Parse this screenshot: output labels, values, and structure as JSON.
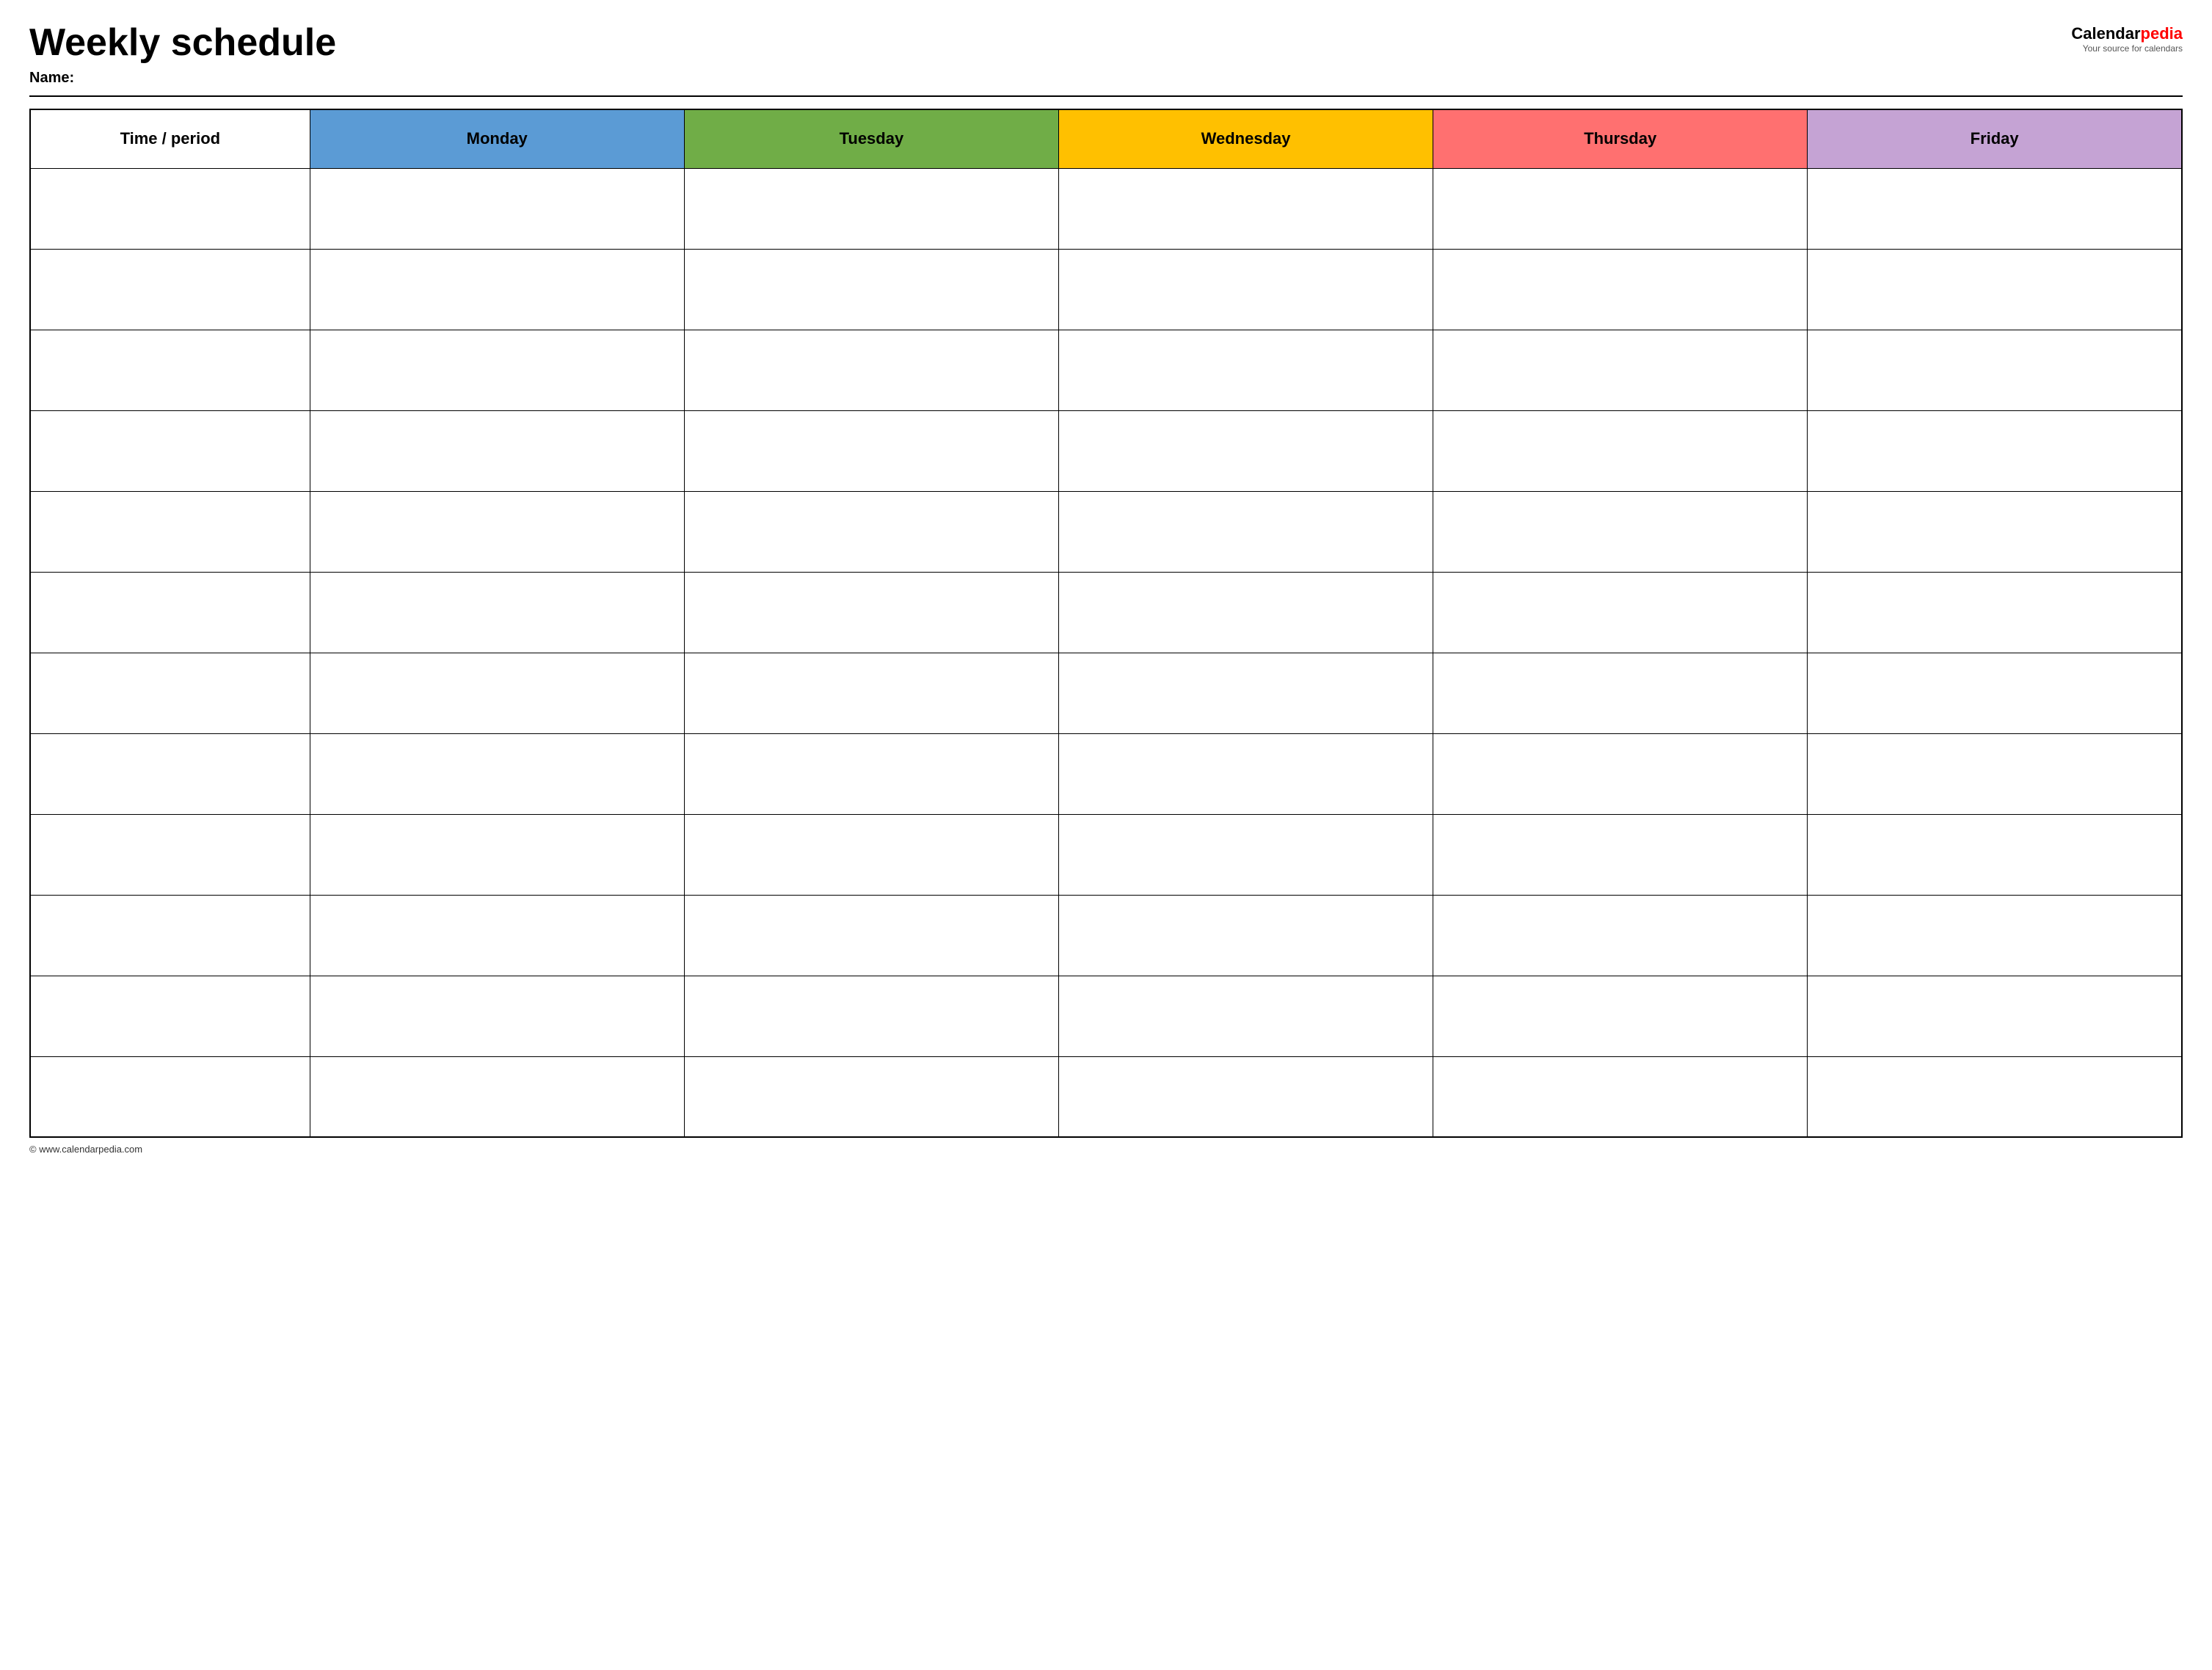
{
  "header": {
    "title": "Weekly schedule",
    "name_label": "Name:",
    "logo_calendar": "Calendar",
    "logo_pedia": "pedia",
    "logo_tagline": "Your source for calendars"
  },
  "table": {
    "columns": [
      {
        "id": "time",
        "label": "Time / period",
        "color": "#ffffff"
      },
      {
        "id": "monday",
        "label": "Monday",
        "color": "#5b9bd5"
      },
      {
        "id": "tuesday",
        "label": "Tuesday",
        "color": "#70ad47"
      },
      {
        "id": "wednesday",
        "label": "Wednesday",
        "color": "#ffc000"
      },
      {
        "id": "thursday",
        "label": "Thursday",
        "color": "#ff7070"
      },
      {
        "id": "friday",
        "label": "Friday",
        "color": "#c5a3d4"
      }
    ],
    "rows": 12
  },
  "footer": {
    "copyright": "© www.calendarpedia.com"
  }
}
